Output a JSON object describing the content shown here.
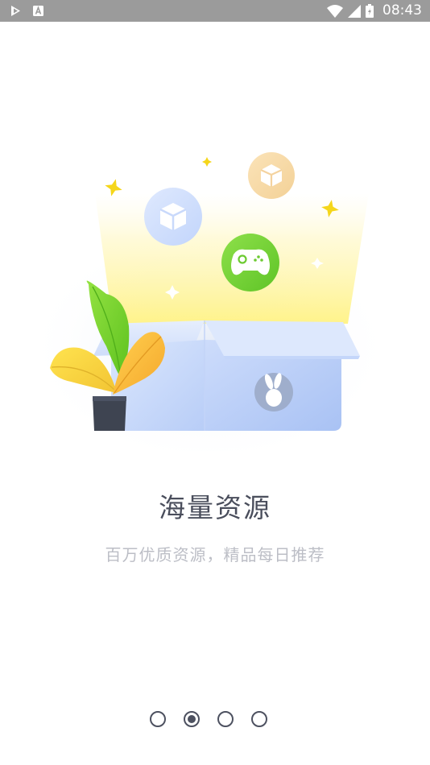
{
  "status_bar": {
    "time": "08:43",
    "left_icons": [
      "play-store-icon",
      "accessibility-a-icon"
    ],
    "right_icons": [
      "wifi-icon",
      "cell-signal-icon",
      "battery-icon"
    ]
  },
  "onboarding": {
    "title": "海量资源",
    "subtitle": "百万优质资源，精品每日推荐",
    "illustration_icons": [
      "cube-bubble-icon",
      "cube-bubble-icon",
      "gamepad-icon",
      "rabbit-logo-icon",
      "sparkle-icon",
      "plant-pot-icon",
      "open-box-icon"
    ]
  },
  "pager": {
    "count": 4,
    "active_index": 1
  },
  "colors": {
    "status_bar_bg": "#9b9b9b",
    "title": "#4a4e5c",
    "subtitle": "#bcbec6",
    "pager": "#4d5160",
    "gamepad_green": "#7bd43b",
    "box_blue": "#bcd3fb",
    "glow_yellow": "#fff59a"
  }
}
